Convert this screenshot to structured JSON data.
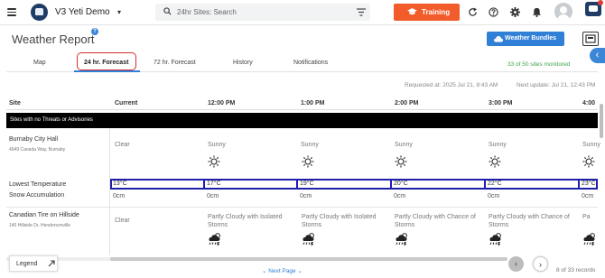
{
  "app": {
    "name": "V3 Yeti Demo",
    "search_placeholder": "24hr Sites: Search",
    "training_label": "Training",
    "colors": {
      "accent": "#2f80d6",
      "training": "#f25c2b",
      "brand": "#1e3c66",
      "success": "#3da34a",
      "highlight": "#1f1fa8"
    }
  },
  "page": {
    "title": "Weather Report",
    "help_badge": "?",
    "bundles_label": "Weather Bundles",
    "site_count": "33 of 50 sites monitored",
    "requested": "Requested at: 2025 Jul 21, 8:43 AM",
    "next_update": "Next update: Jul 21, 12:43 PM"
  },
  "tabs": [
    {
      "label": "Map"
    },
    {
      "label": "24 hr. Forecast"
    },
    {
      "label": "72 hr. Forecast"
    },
    {
      "label": "History"
    },
    {
      "label": "Notifications"
    }
  ],
  "table": {
    "columns": [
      "Site",
      "Current",
      "12:00 PM",
      "1:00 PM",
      "2:00 PM",
      "3:00 PM",
      "4:00"
    ],
    "group_label": "Sites with no Threats or Advisories",
    "row_labels": {
      "low_temp": "Lowest Temperature",
      "snow": "Snow Accumulation"
    },
    "sites": [
      {
        "name": "Burnaby City Hall",
        "address": "4949 Canada Way, Burnaby",
        "conditions": [
          "Clear",
          "Sunny",
          "Sunny",
          "Sunny",
          "Sunny",
          "Sunny"
        ],
        "icons": [
          "sun-icon",
          "sun-icon",
          "sun-icon",
          "sun-icon",
          "sun-icon"
        ],
        "temps": [
          "13°C",
          "17°C",
          "19°C",
          "20°C",
          "22°C",
          "23°C"
        ],
        "snow": [
          "0cm",
          "0cm",
          "0cm",
          "0cm",
          "0cm",
          "0cm"
        ]
      },
      {
        "name": "Canadian Tire on Hillside",
        "address": "140 Hillside Dr, Hendersonville",
        "conditions": [
          "Clear",
          "Partly Cloudy with Isolated Storms",
          "Partly Cloudy with Isolated Storms",
          "Partly Cloudy with Chance of Storms",
          "Partly Cloudy with Chance of Storms",
          "Pa"
        ],
        "icons": [
          "storm-icon",
          "storm-icon",
          "storm-icon",
          "storm-icon",
          "storm-icon"
        ]
      }
    ]
  },
  "footer": {
    "legend_label": "Legend",
    "next_page": "Next Page",
    "records": "8 of 33 records"
  }
}
